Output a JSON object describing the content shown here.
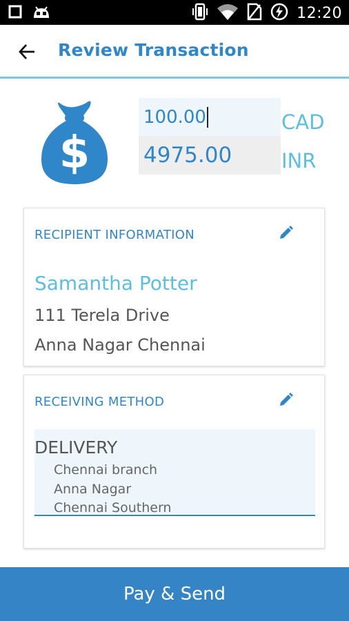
{
  "status_bar": {
    "time": "12:20",
    "icons": [
      "square-icon",
      "android-icon",
      "vibrate-icon",
      "wifi-icon",
      "no-sim-icon",
      "battery-charging-icon"
    ]
  },
  "header": {
    "title": "Review Transaction",
    "back_icon": "arrow-back-icon"
  },
  "amounts": {
    "send_value": "100.00",
    "send_currency": "CAD",
    "receive_value": "4975.00",
    "receive_currency": "INR",
    "icon": "money-bag-icon"
  },
  "recipient": {
    "heading": "RECIPIENT INFORMATION",
    "name": "Samantha Potter",
    "address_line1": "111 Terela Drive",
    "address_line2": "Anna Nagar Chennai",
    "edit_icon": "pencil-icon"
  },
  "receiving_method": {
    "heading": "RECEIVING METHOD",
    "type": "DELIVERY",
    "lines": [
      "Chennai branch",
      "Anna Nagar",
      "Chennai Southern"
    ],
    "edit_icon": "pencil-icon"
  },
  "actions": {
    "pay_label": "Pay & Send"
  },
  "colors": {
    "primary": "#2f86c8",
    "accent_light": "#5bbfe0",
    "button": "#3585c6",
    "divider": "#7fc4e0"
  }
}
